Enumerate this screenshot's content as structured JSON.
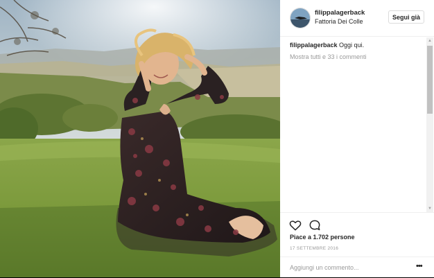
{
  "post": {
    "photo_alt": "",
    "header": {
      "username": "filippalagerback",
      "location": "Fattoria Dei Colle",
      "follow_label": "Segui già"
    },
    "caption": {
      "username": "filippalagerback",
      "text": "Oggi qui."
    },
    "show_all_comments": "Mostra tutti e 33 i commenti",
    "likes_text": "Piace a 1.702 persone",
    "date": "17 SETTEMBRE 2016",
    "add_comment_placeholder": "Aggiungi un commento...",
    "more_options": "•••"
  },
  "icons": {
    "like": "heart-outline-icon",
    "comment": "speech-bubble-icon",
    "scroll_up": "▲",
    "scroll_down": "▼"
  },
  "colors": {
    "text": "#262626",
    "muted": "#999999",
    "border": "#dbdbdb"
  }
}
